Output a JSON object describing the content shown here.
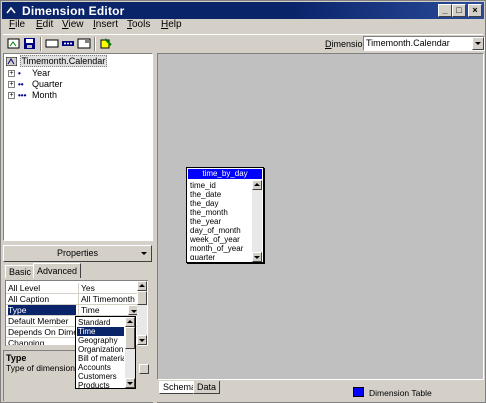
{
  "window": {
    "title": "Dimension Editor",
    "controls": {
      "minimize": "_",
      "maximize": "□",
      "close": "×"
    }
  },
  "menu": [
    {
      "label": "File",
      "underline": "F",
      "rest": "ile"
    },
    {
      "label": "Edit",
      "underline": "E",
      "rest": "dit"
    },
    {
      "label": "View",
      "underline": "V",
      "rest": "iew"
    },
    {
      "label": "Insert",
      "underline": "I",
      "rest": "nsert"
    },
    {
      "label": "Tools",
      "underline": "T",
      "rest": "ools"
    },
    {
      "label": "Help",
      "underline": "H",
      "rest": "elp"
    }
  ],
  "toolbar": {
    "icons": [
      "new-dimension-icon",
      "save-icon",
      "new-level-icon",
      "new-level-dotted-icon",
      "properties-icon",
      "process-icon"
    ],
    "dimension_label_prefix": "D",
    "dimension_label_rest": "imension:",
    "dimension_value": "Timemonth.Calendar"
  },
  "tree": {
    "root": "Timemonth.Calendar",
    "levels": [
      {
        "label": "Year",
        "marker": "•"
      },
      {
        "label": "Quarter",
        "marker": "••"
      },
      {
        "label": "Month",
        "marker": "•••"
      }
    ]
  },
  "properties": {
    "button_label": "Properties",
    "tabs": [
      "Basic",
      "Advanced"
    ],
    "active_tab": "Advanced",
    "rows": [
      {
        "name": "All Level",
        "value": "Yes"
      },
      {
        "name": "All Caption",
        "value": "All Timemonth"
      },
      {
        "name": "Type",
        "value": "Time"
      },
      {
        "name": "Default Member",
        "value": ""
      },
      {
        "name": "Depends On Dimension",
        "value": ""
      },
      {
        "name": "Changing",
        "value": ""
      }
    ],
    "selected_row": "Type",
    "type_options": [
      "Standard",
      "Time",
      "Geography",
      "Organization",
      "Bill of material",
      "Accounts",
      "Customers",
      "Products"
    ],
    "type_selected": "Time"
  },
  "description": {
    "title": "Type",
    "text": "Type of dimension."
  },
  "schema": {
    "table_name": "time_by_day",
    "columns": [
      "time_id",
      "the_date",
      "the_day",
      "the_month",
      "the_year",
      "day_of_month",
      "week_of_year",
      "month_of_year",
      "quarter"
    ]
  },
  "bottom": {
    "tabs": [
      "Schema",
      "Data"
    ],
    "active_tab": "Schema",
    "legend_label": "Dimension Table",
    "legend_color": "#0000ff"
  }
}
